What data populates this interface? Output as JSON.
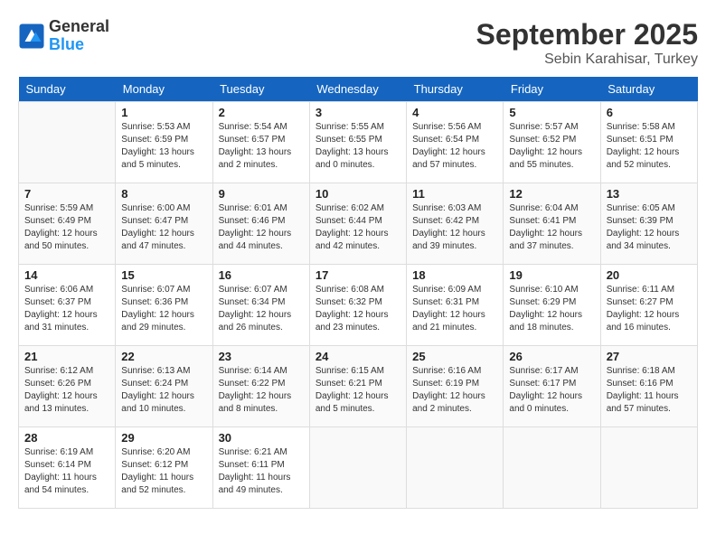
{
  "logo": {
    "general": "General",
    "blue": "Blue"
  },
  "title": "September 2025",
  "subtitle": "Sebin Karahisar, Turkey",
  "days_header": [
    "Sunday",
    "Monday",
    "Tuesday",
    "Wednesday",
    "Thursday",
    "Friday",
    "Saturday"
  ],
  "weeks": [
    [
      {
        "day": "",
        "sunrise": "",
        "sunset": "",
        "daylight": ""
      },
      {
        "day": "1",
        "sunrise": "Sunrise: 5:53 AM",
        "sunset": "Sunset: 6:59 PM",
        "daylight": "Daylight: 13 hours and 5 minutes."
      },
      {
        "day": "2",
        "sunrise": "Sunrise: 5:54 AM",
        "sunset": "Sunset: 6:57 PM",
        "daylight": "Daylight: 13 hours and 2 minutes."
      },
      {
        "day": "3",
        "sunrise": "Sunrise: 5:55 AM",
        "sunset": "Sunset: 6:55 PM",
        "daylight": "Daylight: 13 hours and 0 minutes."
      },
      {
        "day": "4",
        "sunrise": "Sunrise: 5:56 AM",
        "sunset": "Sunset: 6:54 PM",
        "daylight": "Daylight: 12 hours and 57 minutes."
      },
      {
        "day": "5",
        "sunrise": "Sunrise: 5:57 AM",
        "sunset": "Sunset: 6:52 PM",
        "daylight": "Daylight: 12 hours and 55 minutes."
      },
      {
        "day": "6",
        "sunrise": "Sunrise: 5:58 AM",
        "sunset": "Sunset: 6:51 PM",
        "daylight": "Daylight: 12 hours and 52 minutes."
      }
    ],
    [
      {
        "day": "7",
        "sunrise": "Sunrise: 5:59 AM",
        "sunset": "Sunset: 6:49 PM",
        "daylight": "Daylight: 12 hours and 50 minutes."
      },
      {
        "day": "8",
        "sunrise": "Sunrise: 6:00 AM",
        "sunset": "Sunset: 6:47 PM",
        "daylight": "Daylight: 12 hours and 47 minutes."
      },
      {
        "day": "9",
        "sunrise": "Sunrise: 6:01 AM",
        "sunset": "Sunset: 6:46 PM",
        "daylight": "Daylight: 12 hours and 44 minutes."
      },
      {
        "day": "10",
        "sunrise": "Sunrise: 6:02 AM",
        "sunset": "Sunset: 6:44 PM",
        "daylight": "Daylight: 12 hours and 42 minutes."
      },
      {
        "day": "11",
        "sunrise": "Sunrise: 6:03 AM",
        "sunset": "Sunset: 6:42 PM",
        "daylight": "Daylight: 12 hours and 39 minutes."
      },
      {
        "day": "12",
        "sunrise": "Sunrise: 6:04 AM",
        "sunset": "Sunset: 6:41 PM",
        "daylight": "Daylight: 12 hours and 37 minutes."
      },
      {
        "day": "13",
        "sunrise": "Sunrise: 6:05 AM",
        "sunset": "Sunset: 6:39 PM",
        "daylight": "Daylight: 12 hours and 34 minutes."
      }
    ],
    [
      {
        "day": "14",
        "sunrise": "Sunrise: 6:06 AM",
        "sunset": "Sunset: 6:37 PM",
        "daylight": "Daylight: 12 hours and 31 minutes."
      },
      {
        "day": "15",
        "sunrise": "Sunrise: 6:07 AM",
        "sunset": "Sunset: 6:36 PM",
        "daylight": "Daylight: 12 hours and 29 minutes."
      },
      {
        "day": "16",
        "sunrise": "Sunrise: 6:07 AM",
        "sunset": "Sunset: 6:34 PM",
        "daylight": "Daylight: 12 hours and 26 minutes."
      },
      {
        "day": "17",
        "sunrise": "Sunrise: 6:08 AM",
        "sunset": "Sunset: 6:32 PM",
        "daylight": "Daylight: 12 hours and 23 minutes."
      },
      {
        "day": "18",
        "sunrise": "Sunrise: 6:09 AM",
        "sunset": "Sunset: 6:31 PM",
        "daylight": "Daylight: 12 hours and 21 minutes."
      },
      {
        "day": "19",
        "sunrise": "Sunrise: 6:10 AM",
        "sunset": "Sunset: 6:29 PM",
        "daylight": "Daylight: 12 hours and 18 minutes."
      },
      {
        "day": "20",
        "sunrise": "Sunrise: 6:11 AM",
        "sunset": "Sunset: 6:27 PM",
        "daylight": "Daylight: 12 hours and 16 minutes."
      }
    ],
    [
      {
        "day": "21",
        "sunrise": "Sunrise: 6:12 AM",
        "sunset": "Sunset: 6:26 PM",
        "daylight": "Daylight: 12 hours and 13 minutes."
      },
      {
        "day": "22",
        "sunrise": "Sunrise: 6:13 AM",
        "sunset": "Sunset: 6:24 PM",
        "daylight": "Daylight: 12 hours and 10 minutes."
      },
      {
        "day": "23",
        "sunrise": "Sunrise: 6:14 AM",
        "sunset": "Sunset: 6:22 PM",
        "daylight": "Daylight: 12 hours and 8 minutes."
      },
      {
        "day": "24",
        "sunrise": "Sunrise: 6:15 AM",
        "sunset": "Sunset: 6:21 PM",
        "daylight": "Daylight: 12 hours and 5 minutes."
      },
      {
        "day": "25",
        "sunrise": "Sunrise: 6:16 AM",
        "sunset": "Sunset: 6:19 PM",
        "daylight": "Daylight: 12 hours and 2 minutes."
      },
      {
        "day": "26",
        "sunrise": "Sunrise: 6:17 AM",
        "sunset": "Sunset: 6:17 PM",
        "daylight": "Daylight: 12 hours and 0 minutes."
      },
      {
        "day": "27",
        "sunrise": "Sunrise: 6:18 AM",
        "sunset": "Sunset: 6:16 PM",
        "daylight": "Daylight: 11 hours and 57 minutes."
      }
    ],
    [
      {
        "day": "28",
        "sunrise": "Sunrise: 6:19 AM",
        "sunset": "Sunset: 6:14 PM",
        "daylight": "Daylight: 11 hours and 54 minutes."
      },
      {
        "day": "29",
        "sunrise": "Sunrise: 6:20 AM",
        "sunset": "Sunset: 6:12 PM",
        "daylight": "Daylight: 11 hours and 52 minutes."
      },
      {
        "day": "30",
        "sunrise": "Sunrise: 6:21 AM",
        "sunset": "Sunset: 6:11 PM",
        "daylight": "Daylight: 11 hours and 49 minutes."
      },
      {
        "day": "",
        "sunrise": "",
        "sunset": "",
        "daylight": ""
      },
      {
        "day": "",
        "sunrise": "",
        "sunset": "",
        "daylight": ""
      },
      {
        "day": "",
        "sunrise": "",
        "sunset": "",
        "daylight": ""
      },
      {
        "day": "",
        "sunrise": "",
        "sunset": "",
        "daylight": ""
      }
    ]
  ]
}
